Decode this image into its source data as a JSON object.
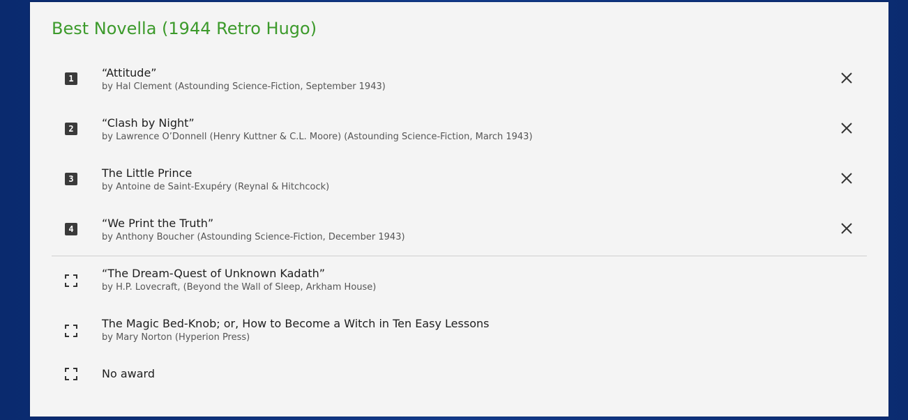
{
  "category_title": "Best Novella (1944 Retro Hugo)",
  "ranked": [
    {
      "rank": "1",
      "title": "“Attitude”",
      "byline": "by Hal Clement (Astounding Science-Fiction, September 1943)"
    },
    {
      "rank": "2",
      "title": "“Clash by Night”",
      "byline": "by Lawrence O’Donnell (Henry Kuttner & C.L. Moore) (Astounding Science-Fiction, March 1943)"
    },
    {
      "rank": "3",
      "title": "The Little Prince",
      "byline": "by Antoine de Saint-Exupéry (Reynal & Hitchcock)"
    },
    {
      "rank": "4",
      "title": "“We Print the Truth”",
      "byline": "by Anthony Boucher (Astounding Science-Fiction, December 1943)"
    }
  ],
  "unranked": [
    {
      "title": "“The Dream-Quest of Unknown Kadath”",
      "byline": "by H.P. Lovecraft, (Beyond the Wall of Sleep, Arkham House)"
    },
    {
      "title": "The Magic Bed-Knob; or, How to Become a Witch in Ten Easy Lessons",
      "byline": "by Mary Norton (Hyperion Press)"
    },
    {
      "title": "No award",
      "byline": ""
    }
  ],
  "icons": {
    "remove": "close-icon",
    "empty_slot": "empty-slot-icon"
  },
  "colors": {
    "title": "#3c9a2b",
    "badge": "#3a3a3a",
    "background": "#0f3380"
  }
}
